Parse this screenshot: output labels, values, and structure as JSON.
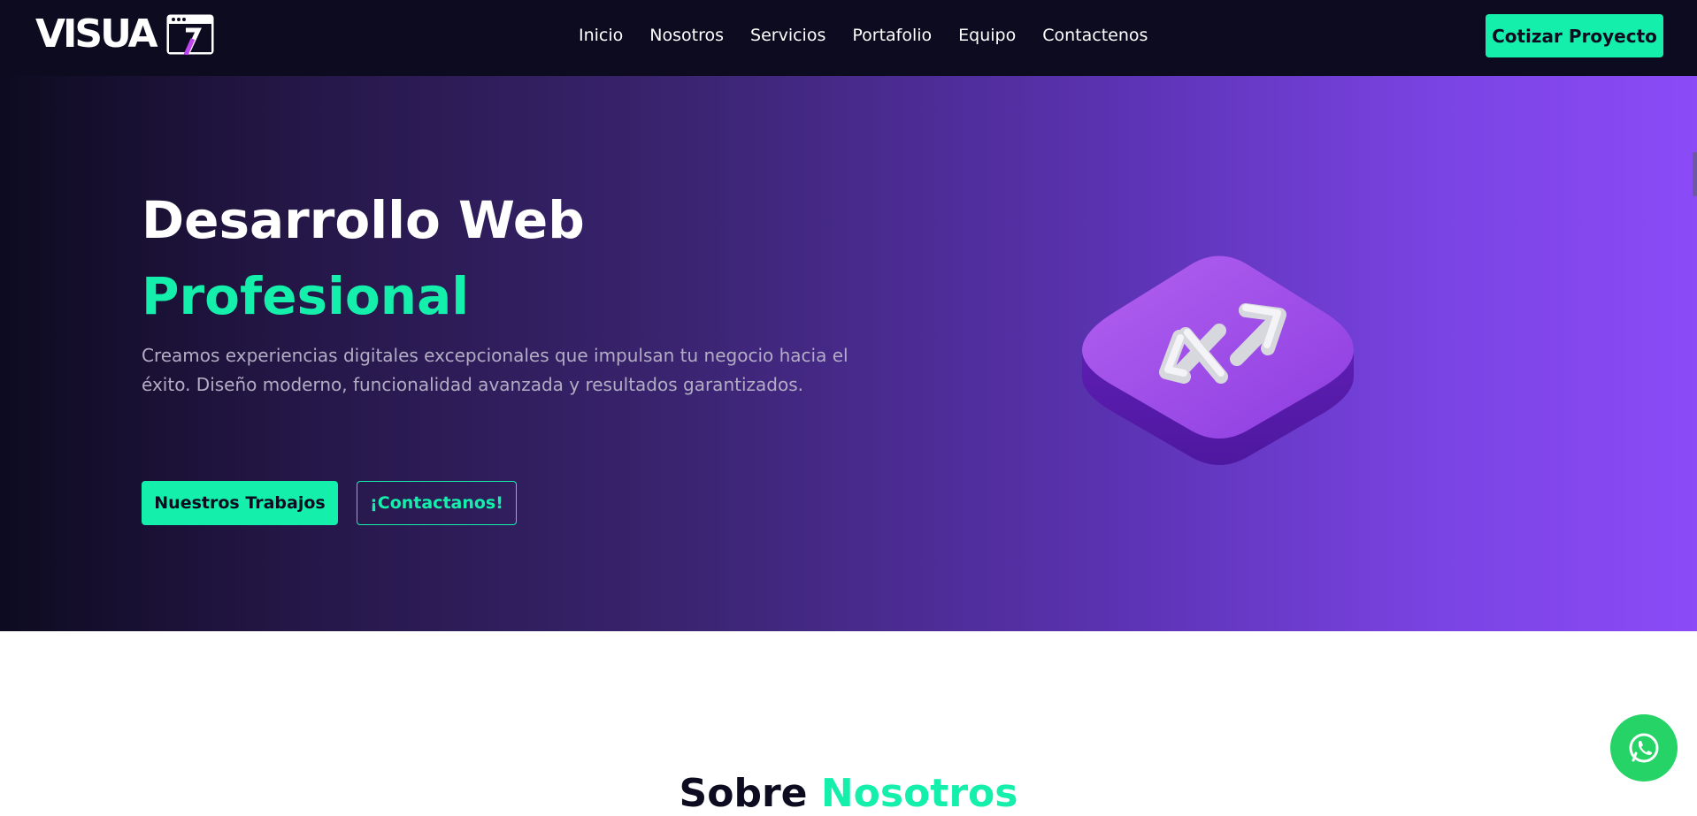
{
  "header": {
    "logo_text": "VISUA",
    "nav": [
      "Inicio",
      "Nosotros",
      "Servicios",
      "Portafolio",
      "Equipo",
      "Contactenos"
    ],
    "cta_label": "Cotizar Proyecto"
  },
  "hero": {
    "title_line1": "Desarrollo Web",
    "title_line2": "Profesional",
    "description": "Creamos experiencias digitales excepcionales que impulsan tu negocio hacia el éxito. Diseño moderno, funcionalidad avanzada y resultados garantizados.",
    "primary_button": "Nuestros Trabajos",
    "secondary_button": "¡Contactanos!",
    "graphic_icon": "transfer-arrows-icon"
  },
  "about": {
    "title_part1": "Sobre",
    "title_part2": "Nosotros"
  },
  "floating": {
    "icon": "whatsapp-icon"
  },
  "colors": {
    "accent": "#14f0ab",
    "header_bg": "#0d0b20",
    "hero_gradient_start": "#0d0b20",
    "hero_gradient_end": "#8b4bf7",
    "whatsapp": "#25d366"
  }
}
